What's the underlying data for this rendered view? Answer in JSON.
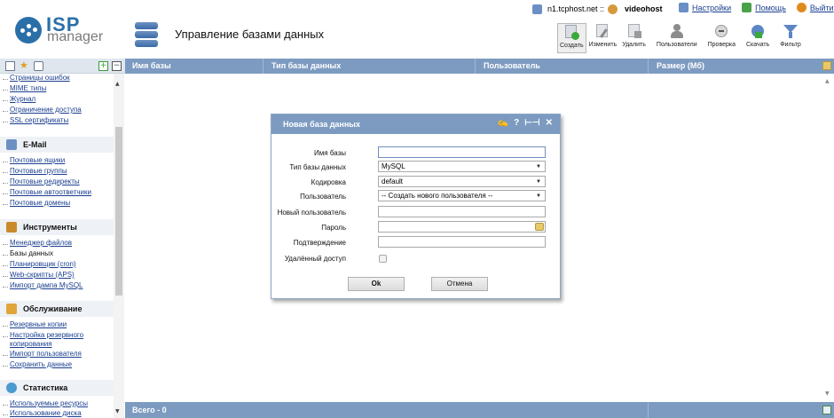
{
  "logo": {
    "brand": "ISP",
    "product": "manager"
  },
  "page_title": "Управление базами данных",
  "host": {
    "server": "n1.tcphost.net ::",
    "user": "videohost"
  },
  "top_links": [
    {
      "label": "Настройки"
    },
    {
      "label": "Помощь"
    },
    {
      "label": "Выйти"
    }
  ],
  "toolbar": {
    "create": "Создать",
    "edit": "Изменить",
    "delete": "Удалить",
    "users": "Пользователи",
    "check": "Проверка",
    "download": "Скачать",
    "filter": "Фильтр"
  },
  "sidebar": {
    "top_links": [
      "Страницы ошибок",
      "MIME типы",
      "Журнал",
      "Ограничение доступа",
      "SSL сертификаты"
    ],
    "groups": [
      {
        "title": "E-Mail",
        "items": [
          "Почтовые ящики",
          "Почтовые группы",
          "Почтовые редиректы",
          "Почтовые автоответчики",
          "Почтовые домены"
        ]
      },
      {
        "title": "Инструменты",
        "items": [
          "Менеджер файлов",
          "Базы данных",
          "Планировщик (cron)",
          "Web-скрипты (APS)",
          "Импорт дампа MySQL"
        ]
      },
      {
        "title": "Обслуживание",
        "items": [
          "Резервные копии",
          "Настройка резервного копирования",
          "Импорт пользователя",
          "Сохранить данные"
        ]
      },
      {
        "title": "Статистика",
        "items": [
          "Используемые ресурсы",
          "Использование диска"
        ]
      }
    ]
  },
  "grid": {
    "columns": [
      "Имя базы",
      "Тип базы данных",
      "Пользователь",
      "Размер (Мб)"
    ],
    "footer": "Всего - 0"
  },
  "dialog": {
    "title": "Новая база данных",
    "controls": [
      "✍",
      "?",
      "⊢⊣",
      "✕"
    ],
    "fields": {
      "db_name": {
        "label": "Имя базы",
        "value": ""
      },
      "db_type": {
        "label": "Тип базы данных",
        "value": "MySQL"
      },
      "encoding": {
        "label": "Кодировка",
        "value": "default"
      },
      "user": {
        "label": "Пользователь",
        "value": "-- Создать нового пользователя --"
      },
      "new_user": {
        "label": "Новый пользователь",
        "value": ""
      },
      "password": {
        "label": "Пароль",
        "value": ""
      },
      "confirm": {
        "label": "Подтверждение",
        "value": ""
      },
      "remote": {
        "label": "Удалённый доступ",
        "checked": false
      }
    },
    "ok": "Ok",
    "cancel": "Отмена"
  },
  "colors": {
    "header_blue": "#7d9bc1",
    "link_blue": "#1a3f8f",
    "logo_blue": "#2b6fa8"
  }
}
